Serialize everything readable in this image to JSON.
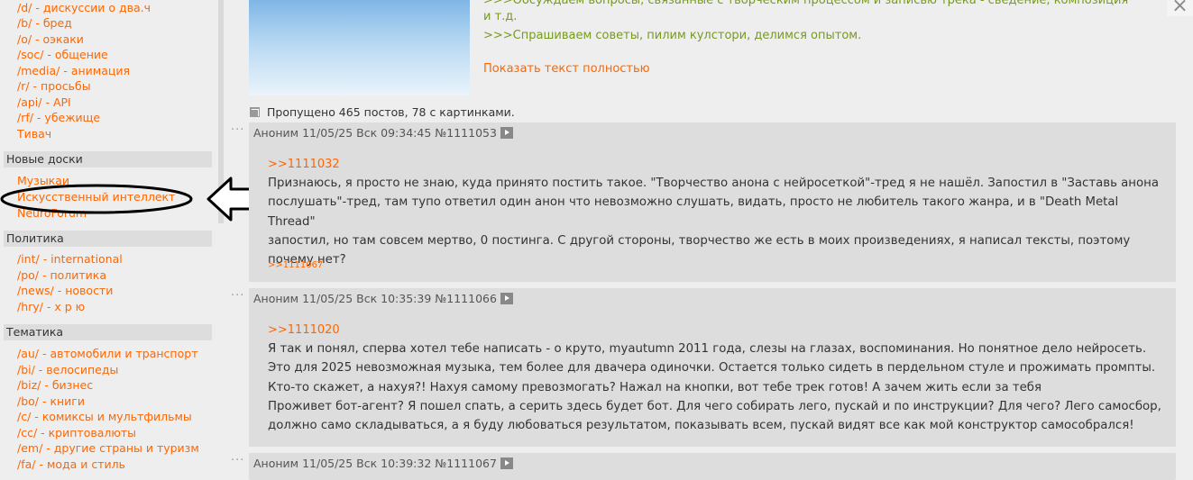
{
  "sidebar": {
    "boards_top": [
      "/d/ - дискуссии о два.ч",
      "/b/ - бред",
      "/o/ - оэкаки",
      "/soc/ - общение",
      "/media/ - анимация",
      "/r/ - просьбы",
      "/api/ - API",
      "/rf/ - убежище",
      "Тивач"
    ],
    "section_new": "Новые доски",
    "boards_new": [
      "Музыкаи",
      "Искусственный интеллект",
      "NeuroForum"
    ],
    "section_politics": "Политика",
    "boards_politics": [
      "/int/ - international",
      "/po/ - политика",
      "/news/ - новости",
      "/hry/ - х р ю"
    ],
    "section_themes": "Тематика",
    "boards_themes": [
      "/au/ - автомобили и транспорт",
      "/bi/ - велосипеды",
      "/biz/ - бизнес",
      "/bo/ - книги",
      "/c/ - комиксы и мультфильмы",
      "/cc/ - криптовалюты",
      "/em/ - другие страны и туризм",
      "/fa/ - мода и стиль"
    ]
  },
  "op": {
    "quote_1": ">>>Обсуждаем вопросы, связанные с творческим процессом и записью трека - сведение, композиция",
    "quote_1b": "и т.д.",
    "quote_2": ">>>Спрашиваем советы, пилим кулстори, делимся опытом.",
    "show_full": "Показать текст полностью",
    "close": "×"
  },
  "omitted": "Пропущено 465 постов, 78 с картинками.",
  "posts": [
    {
      "header": "Аноним 11/05/25 Вск 09:34:45 №1111053",
      "reply_to": ">>1111032",
      "body": [
        "Признаюсь, я просто не знаю, куда принято постить такое. \"Творчество анона с нейросеткой\"-тред я не нашёл. Запостил в \"Заставь анона",
        "послушать\"-тред, там тупо ответил один анон что невозможно слушать, видать, просто не любитель такого жанра, и в \"Death Metal Thread\"",
        "запостил, но там совсем мертво, 0 постинга. С другой стороны, творчество же есть в моих произведениях, я написал тексты, поэтому",
        "почему нет?"
      ],
      "backlink": ">>1111067"
    },
    {
      "header": "Аноним 11/05/25 Вск 10:35:39 №1111066",
      "reply_to": ">>1111020",
      "body": [
        "Я так и понял, сперва хотел тебе написать - о круто, myautumn 2011 года, слезы на глазах, воспоминания. Но понятное дело нейросеть.",
        "Это для 2025 невозможная музыка, тем более для двачера одиночки. Остается только сидеть в пердельном стуле и прожимать промпты.",
        "Кто-то скажет, а нахуя?! Нахуя самому превозмогать? Нажал на кнопки, вот тебе трек готов! А зачем жить если за тебя",
        "Проживет бот-агент? Я пошел спать, а серить здесь будет бот. Для чего собирать лего, пускай и по инструкции? Для чего? Лего самосбор,",
        "должно само складываться, а я буду любоваться результатом, показывать всем, пускай видят все как мой конструктор самособрался!"
      ]
    },
    {
      "header": "Аноним 11/05/25 Вск 10:39:32 №1111067"
    }
  ],
  "post_dots": "···"
}
